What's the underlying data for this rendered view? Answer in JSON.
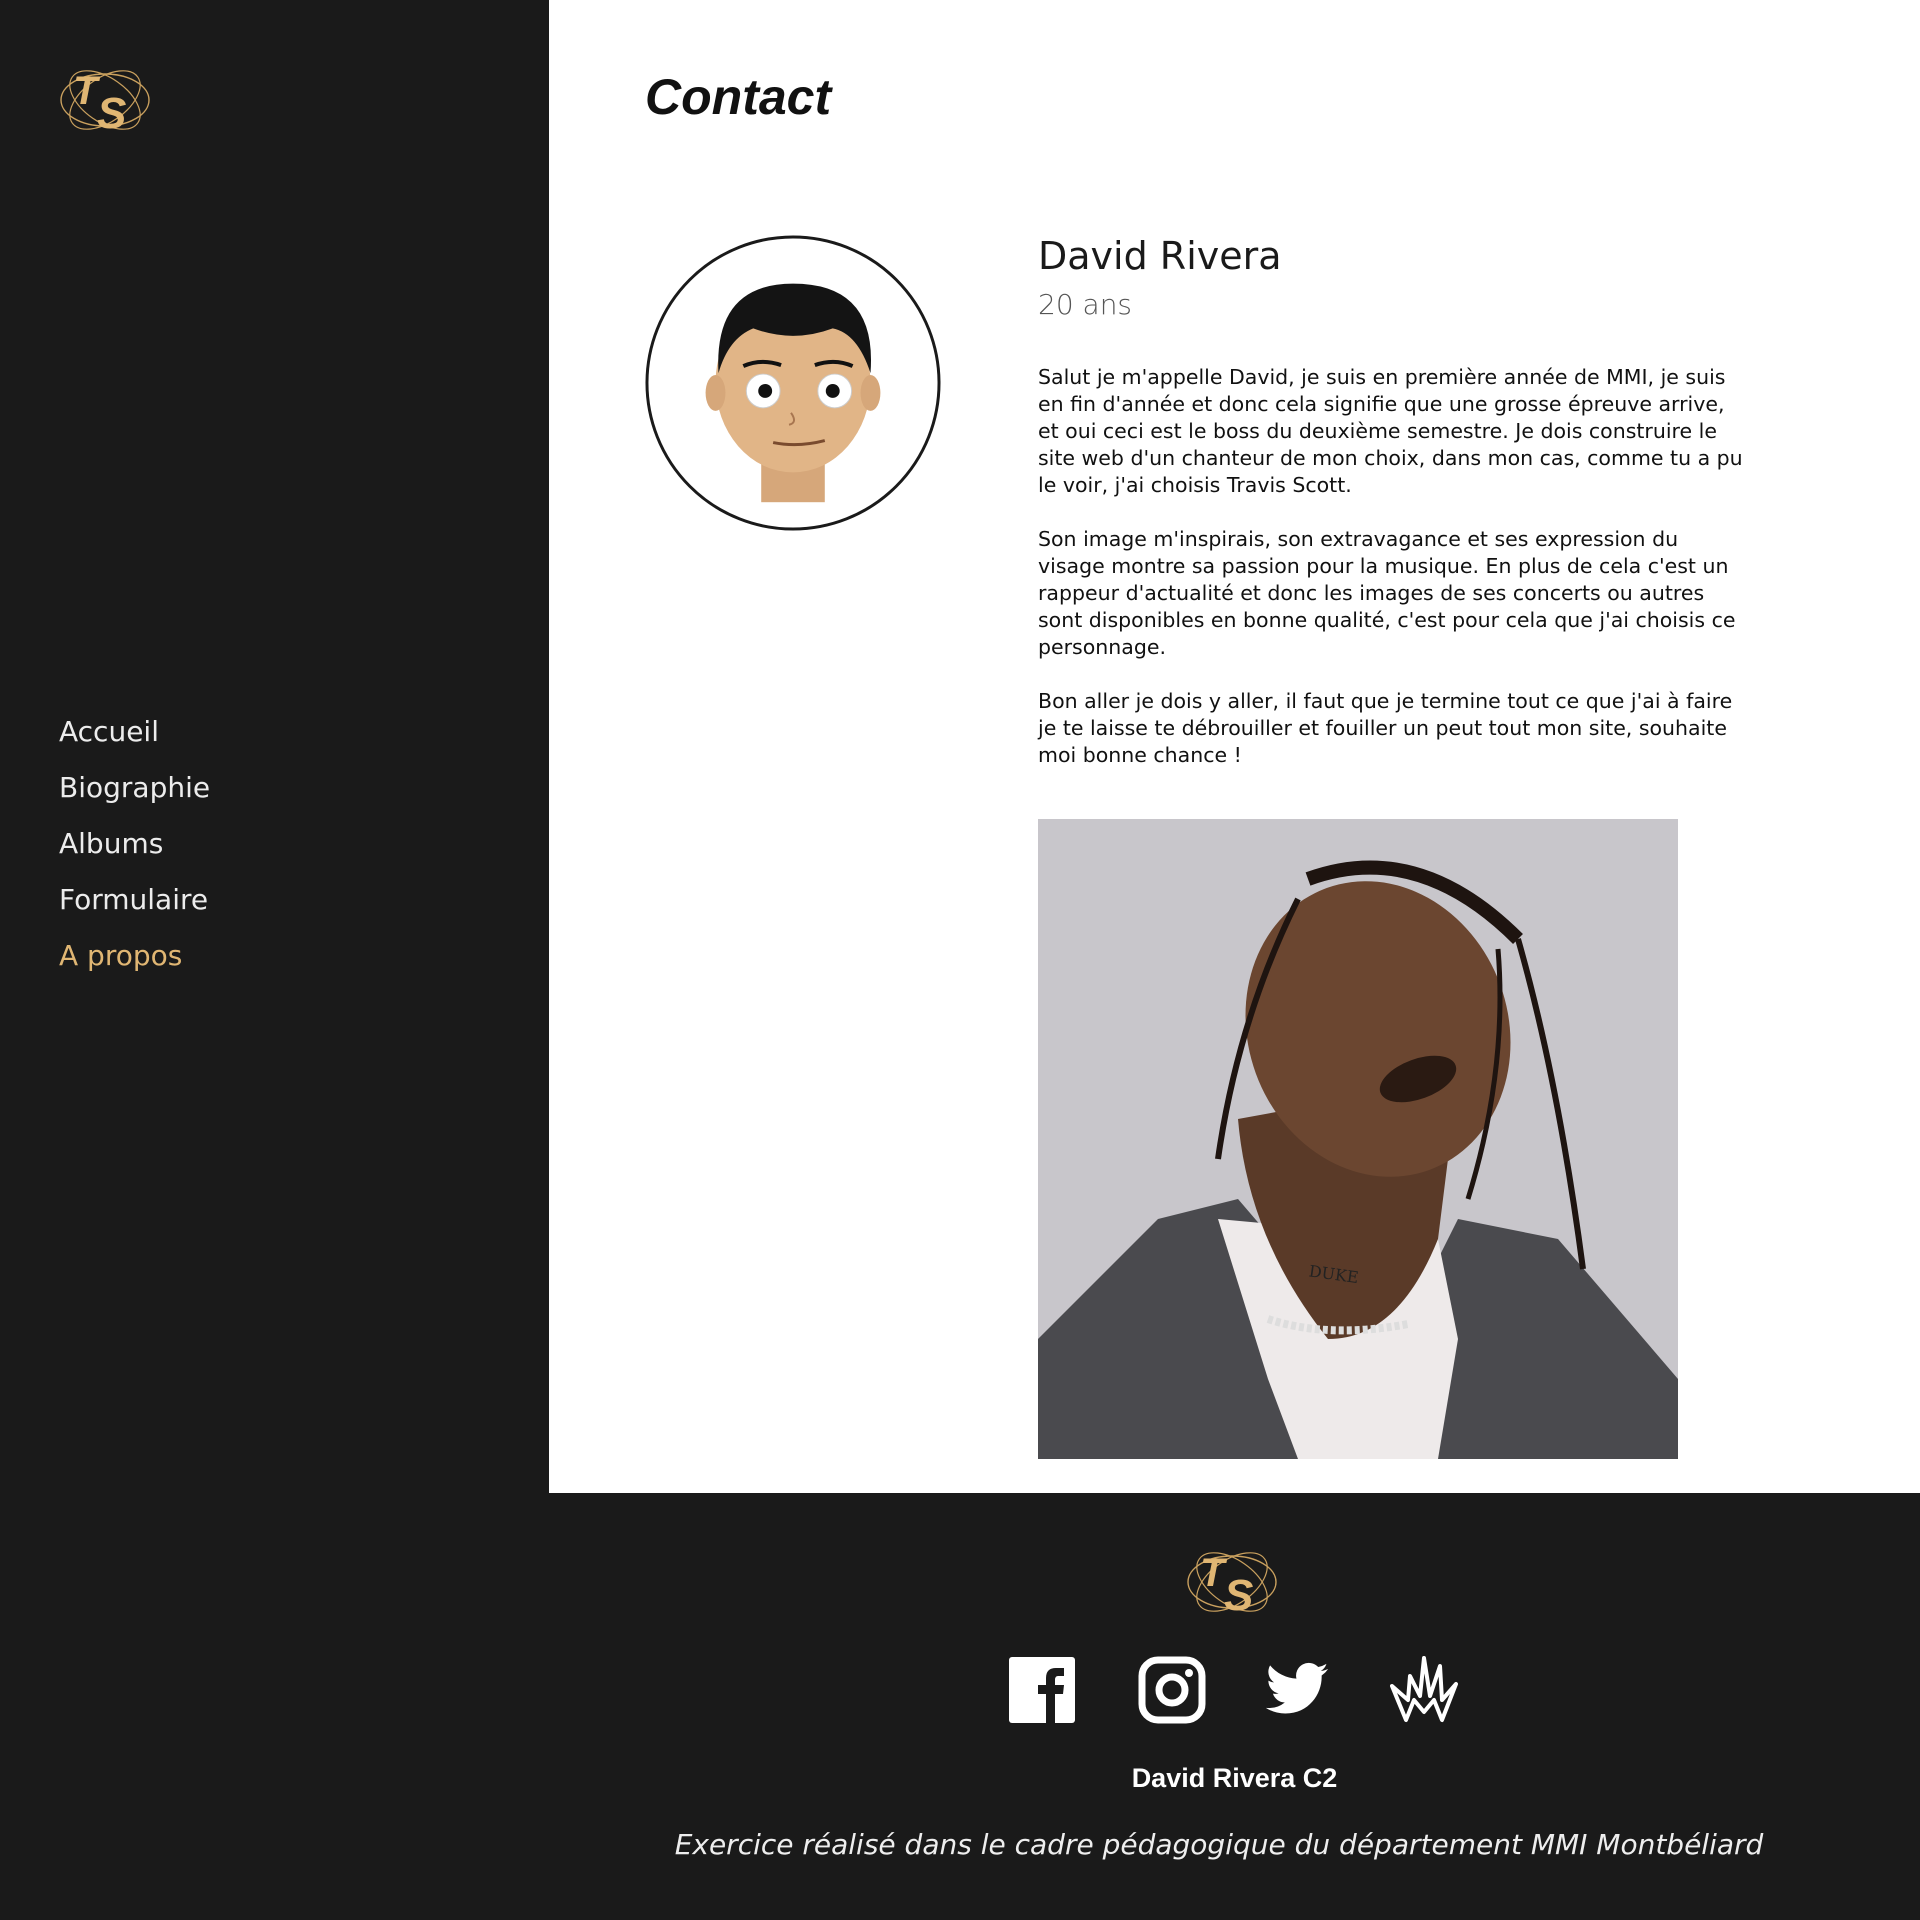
{
  "brand": {
    "logo_text": "TS",
    "accent": "#e0b673"
  },
  "nav": {
    "items": [
      {
        "label": "Accueil"
      },
      {
        "label": "Biographie"
      },
      {
        "label": "Albums"
      },
      {
        "label": "Formulaire"
      },
      {
        "label": "A propos",
        "active": true
      }
    ]
  },
  "main": {
    "title": "Contact",
    "name": "David Rivera",
    "age": "20 ans",
    "paragraphs": [
      "Salut je m'appelle David, je suis en première année de MMI, je suis en fin d'année et donc cela signifie que une grosse épreuve arrive, et oui ceci est le boss du deuxième semestre. Je dois construire le site web d'un chanteur de mon choix, dans mon cas, comme tu a pu le voir, j'ai choisis Travis Scott.",
      "Son image m'inspirais, son extravagance et ses expression du visage montre sa passion pour la musique. En plus de cela c'est un rappeur d'actualité et donc les images de ses concerts ou autres sont disponibles en bonne qualité, c'est pour cela que j'ai choisis ce personnage.",
      "Bon aller je dois y aller, il faut que je termine tout ce que j'ai à faire je te laisse te débrouiller et fouiller un peut tout mon site, souhaite moi bonne chance !"
    ],
    "portrait_tattoo": "DUKE"
  },
  "footer": {
    "social": [
      "facebook-icon",
      "instagram-icon",
      "twitter-icon",
      "cactus-jack-icon"
    ],
    "name": "David Rivera C2",
    "credit": "Exercice réalisé dans le cadre pédagogique du département MMI Montbéliard"
  }
}
